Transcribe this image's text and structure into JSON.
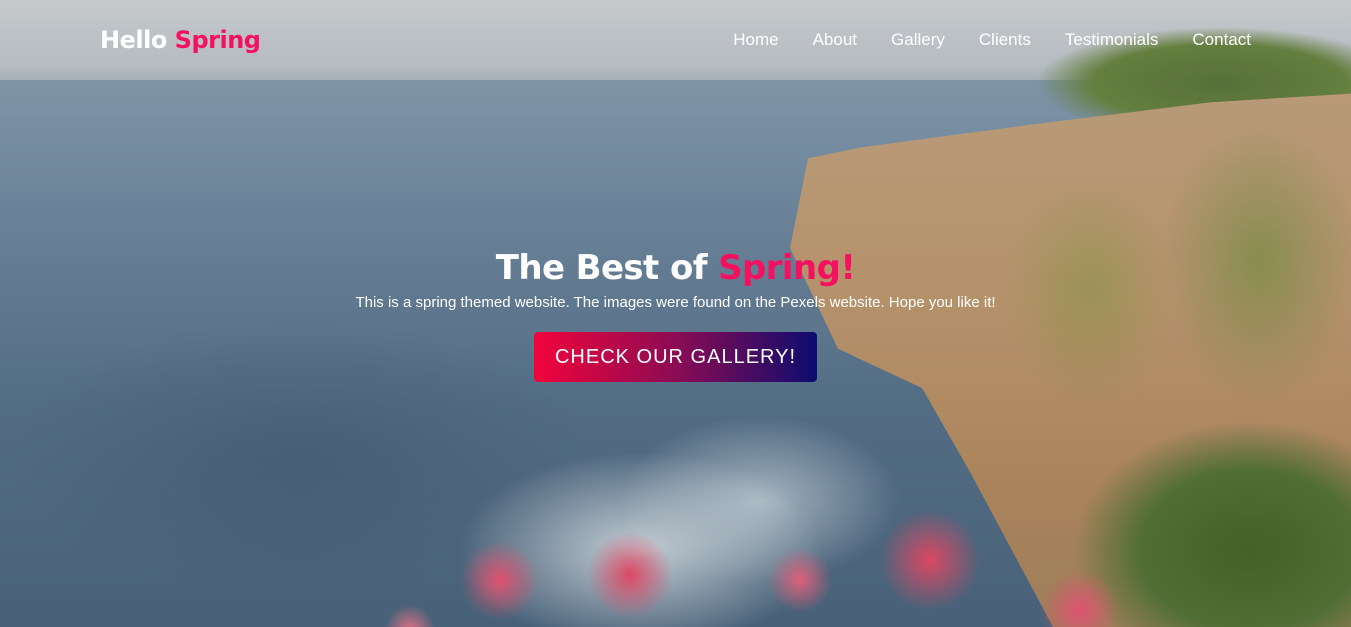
{
  "brand": {
    "first": "Hello",
    "second": "Spring"
  },
  "nav": {
    "items": [
      {
        "label": "Home"
      },
      {
        "label": "About"
      },
      {
        "label": "Gallery"
      },
      {
        "label": "Clients"
      },
      {
        "label": "Testimonials"
      },
      {
        "label": "Contact"
      }
    ]
  },
  "hero": {
    "headline_part1": "The Best of ",
    "headline_part2": "Spring!",
    "tagline": "This is a spring themed website. The images were found on the Pexels website. Hope you like it!",
    "cta_label": "CHECK OUR GALLERY!"
  },
  "colors": {
    "accent": "#f5115f",
    "cta_gradient_start": "#f2043b",
    "cta_gradient_end": "#0d0c6e",
    "text": "#ffffff"
  }
}
